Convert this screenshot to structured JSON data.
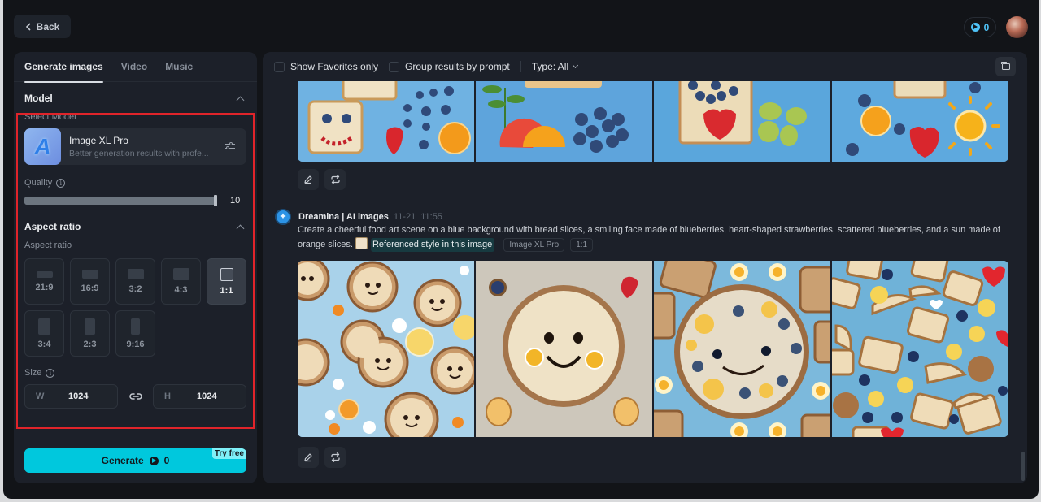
{
  "header": {
    "back_label": "Back",
    "credits": "0"
  },
  "left": {
    "tabs": [
      {
        "label": "Generate images",
        "active": true
      },
      {
        "label": "Video",
        "active": false
      },
      {
        "label": "Music",
        "active": false
      }
    ],
    "model_section": {
      "title": "Model",
      "select_label": "Select Model",
      "model_name": "Image XL Pro",
      "model_desc": "Better generation results with profe...",
      "model_glyph": "A"
    },
    "quality": {
      "label": "Quality",
      "value": "10",
      "fraction": 1.0
    },
    "aspect_section": {
      "title": "Aspect ratio",
      "sub_label": "Aspect ratio",
      "options": [
        {
          "label": "21:9",
          "selected": false
        },
        {
          "label": "16:9",
          "selected": false
        },
        {
          "label": "3:2",
          "selected": false
        },
        {
          "label": "4:3",
          "selected": false
        },
        {
          "label": "1:1",
          "selected": true
        },
        {
          "label": "3:4",
          "selected": false
        },
        {
          "label": "2:3",
          "selected": false
        },
        {
          "label": "9:16",
          "selected": false
        }
      ]
    },
    "size": {
      "label": "Size",
      "w_prefix": "W",
      "w_value": "1024",
      "h_prefix": "H",
      "h_value": "1024"
    },
    "generate": {
      "label": "Generate",
      "cost": "0",
      "badge": "Try free"
    }
  },
  "right": {
    "toolbar": {
      "favorites_label": "Show Favorites only",
      "group_label": "Group results by prompt",
      "type_label": "Type: All"
    },
    "generation": {
      "bot_name": "Dreamina | AI images",
      "date": "11-21",
      "time": "11:55",
      "prompt": "Create a cheerful food art scene on a blue background with bread slices, a smiling face made of blueberries, heart-shaped strawberries, scattered blueberries, and a sun made of orange slices.",
      "ref_label": "Referenced style in this image",
      "tags": [
        "Image XL Pro",
        "1:1"
      ]
    },
    "images_top": [
      {
        "alt": "Bread slice with blueberry eyes and cherry smile, strawberry, blueberries and orange slice"
      },
      {
        "alt": "Grapefruit and orange slices with leaf and blueberry cluster"
      },
      {
        "alt": "Bread with strawberry heart and blueberries, green grapes"
      },
      {
        "alt": "Orange slices, heart strawberry and a sun made of orange"
      }
    ],
    "images_bottom": [
      {
        "alt": "Cartoon smiling cookies pattern on blue background"
      },
      {
        "alt": "Large smiling pancake on beige background"
      },
      {
        "alt": "Smiling pancake with blueberries on blue background"
      },
      {
        "alt": "Cartoon bread slices, suns and hearts pattern"
      }
    ]
  }
}
